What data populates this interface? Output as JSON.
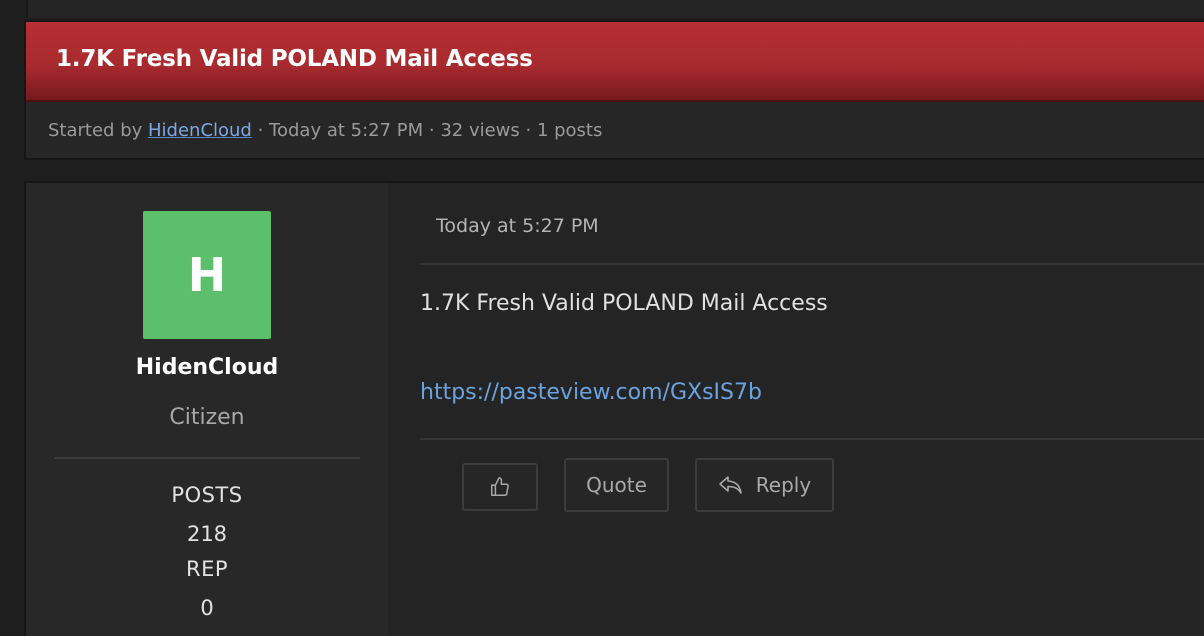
{
  "thread": {
    "title": "1.7K Fresh Valid POLAND Mail Access",
    "meta": {
      "started_by_label": "Started by ",
      "author": "HidenCloud",
      "details": " · Today at 5:27 PM · 32 views · 1 posts"
    }
  },
  "post": {
    "author": {
      "avatar_letter": "H",
      "username": "HidenCloud",
      "rank": "Citizen",
      "stats": [
        {
          "label": "POSTS",
          "value": "218"
        },
        {
          "label": "REP",
          "value": "0"
        }
      ]
    },
    "date": "Today at 5:27 PM",
    "body_text": "1.7K Fresh Valid POLAND Mail Access",
    "body_link": "https://pasteview.com/GXsIS7b",
    "actions": {
      "like_icon": "thumbs-up-icon",
      "quote_label": "Quote",
      "reply_label": "Reply",
      "reply_icon": "reply-arrow-icon"
    }
  },
  "colors": {
    "title_bar": "#b52f33",
    "avatar_bg": "#5bbf6c",
    "link": "#6aa3df",
    "background": "#1e1e1e"
  }
}
